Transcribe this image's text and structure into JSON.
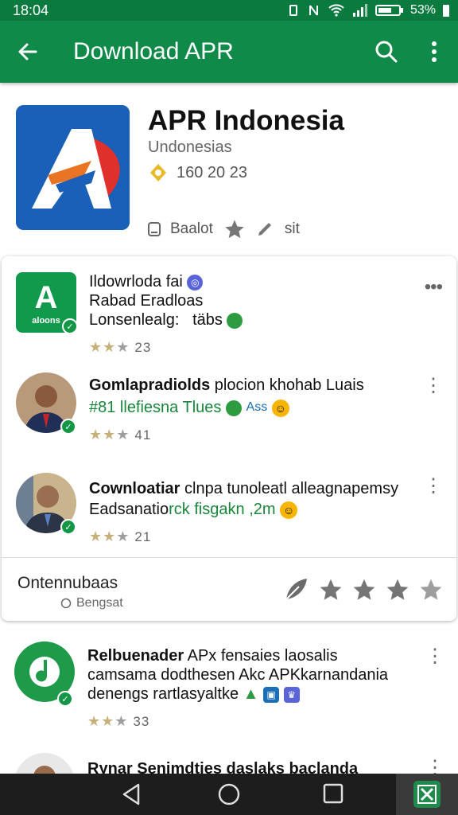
{
  "status_bar": {
    "time": "18:04",
    "battery": "53%"
  },
  "toolbar": {
    "title": "Download APR"
  },
  "app": {
    "name": "APR Indonesia",
    "publisher": "Undonesias",
    "rating_text": "160 20 23",
    "meta_left": "Baalot",
    "meta_right": "sit"
  },
  "list": [
    {
      "line1": "Ildowrloda fai",
      "line2": "Rabad Eradloas",
      "line3": "Lonsenlealg:   täbs",
      "avatar_text": "A",
      "avatar_sub": "aloons",
      "star_count": "23"
    },
    {
      "title": "Gomlapradiolds",
      "line1_rest": " plocion khohab Luais",
      "line2": "#81 llefiesna Tlues",
      "line2_rest": "Ass",
      "star_count": "41"
    },
    {
      "title": "Cownloatiar",
      "line1_rest": " clnpa tunoleatl alleagnapemsy",
      "line2": "Eadsanatio",
      "line2_rest": "rck fisgakn ,2m",
      "star_count": "21"
    },
    {
      "title": "Relbuenader",
      "line1_rest": " APx fensaies laosalis",
      "line2": "camsama dodthesen Akc APKkarnandania",
      "line3": "denengs rartlasyaltke",
      "star_count": "33"
    },
    {
      "title": "Rynar Senimdties daslaks baclanda"
    }
  ],
  "card_footer": {
    "title": "Ontennubaas",
    "subtitle": "Bengsat"
  },
  "colors": {
    "toolbar": "#0f8a48",
    "statusbar": "#0b7a3e",
    "accent_green": "#129a4c"
  }
}
